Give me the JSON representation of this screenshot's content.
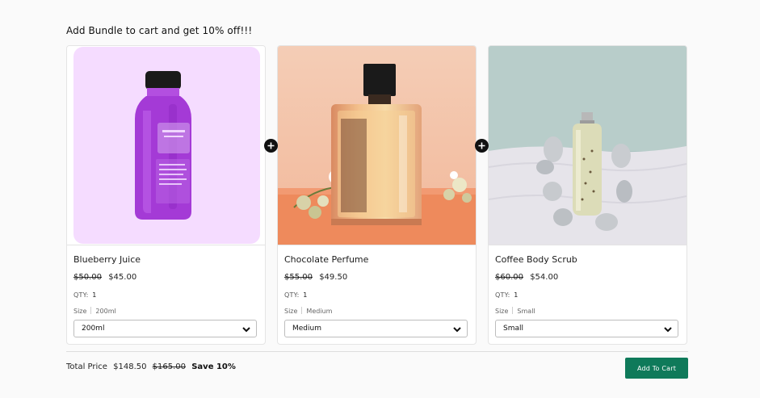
{
  "heading": "Add Bundle to cart and get 10% off!!!",
  "products": [
    {
      "name": "Blueberry Juice",
      "old_price": "$50.00",
      "price": "$45.00",
      "qty_label": "QTY:",
      "qty": "1",
      "size_label": "Size",
      "size_value": "200ml",
      "selected": "200ml",
      "image_icon": "juice-bottle-image"
    },
    {
      "name": "Chocolate Perfume",
      "old_price": "$55.00",
      "price": "$49.50",
      "qty_label": "QTY:",
      "qty": "1",
      "size_label": "Size",
      "size_value": "Medium",
      "selected": "Medium",
      "image_icon": "perfume-bottle-image"
    },
    {
      "name": "Coffee Body Scrub",
      "old_price": "$60.00",
      "price": "$54.00",
      "qty_label": "QTY:",
      "qty": "1",
      "size_label": "Size",
      "size_value": "Small",
      "selected": "Small",
      "image_icon": "scrub-bottle-image"
    }
  ],
  "footer": {
    "total_label": "Total Price",
    "total_price": "$148.50",
    "original_total": "$165.00",
    "save_text": "Save 10%",
    "button_label": "Add To Cart"
  },
  "colors": {
    "button": "#0f7a5a",
    "juice_bg": "#f5dcff",
    "juice_bottle": "#a43ad6"
  },
  "icons": {
    "plus": "plus-icon",
    "chevron": "chevron-down-icon"
  }
}
